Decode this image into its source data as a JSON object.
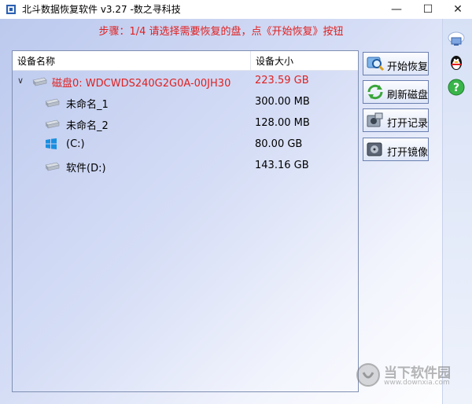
{
  "window": {
    "title": "北斗数据恢复软件 v3.27 -数之寻科技",
    "minimize": "—",
    "maximize": "☐",
    "close": "✕"
  },
  "instruction": "步骤：1/4 请选择需要恢复的盘，点《开始恢复》按钮",
  "table": {
    "headers": [
      "设备名称",
      "设备大小"
    ],
    "rows": [
      {
        "name": "磁盘0: WDCWDS240G2G0A-00JH30",
        "size": "223.59 GB",
        "icon": "hard-disk-icon",
        "highlight": true
      },
      {
        "name": "未命名_1",
        "size": "300.00 MB",
        "icon": "hard-disk-icon",
        "highlight": false
      },
      {
        "name": "未命名_2",
        "size": "128.00 MB",
        "icon": "hard-disk-icon",
        "highlight": false
      },
      {
        "name": "(C:)",
        "size": "80.00 GB",
        "icon": "windows-icon",
        "highlight": false
      },
      {
        "name": "软件(D:)",
        "size": "143.16 GB",
        "icon": "hard-disk-icon",
        "highlight": false
      }
    ]
  },
  "actions": [
    {
      "label": "开始恢复",
      "icon": "search-icon"
    },
    {
      "label": "刷新磁盘",
      "icon": "refresh-icon"
    },
    {
      "label": "打开记录",
      "icon": "camera-icon"
    },
    {
      "label": "打开镜像",
      "icon": "disk-image-icon"
    }
  ],
  "side_icons": [
    "cloud-computer-icon",
    "qq-penguin-icon",
    "help-icon"
  ],
  "watermark": {
    "text": "当下软件园",
    "url": "www.downxia.com"
  },
  "colors": {
    "accent_red": "#e02020",
    "background": "#c9d4f2"
  }
}
